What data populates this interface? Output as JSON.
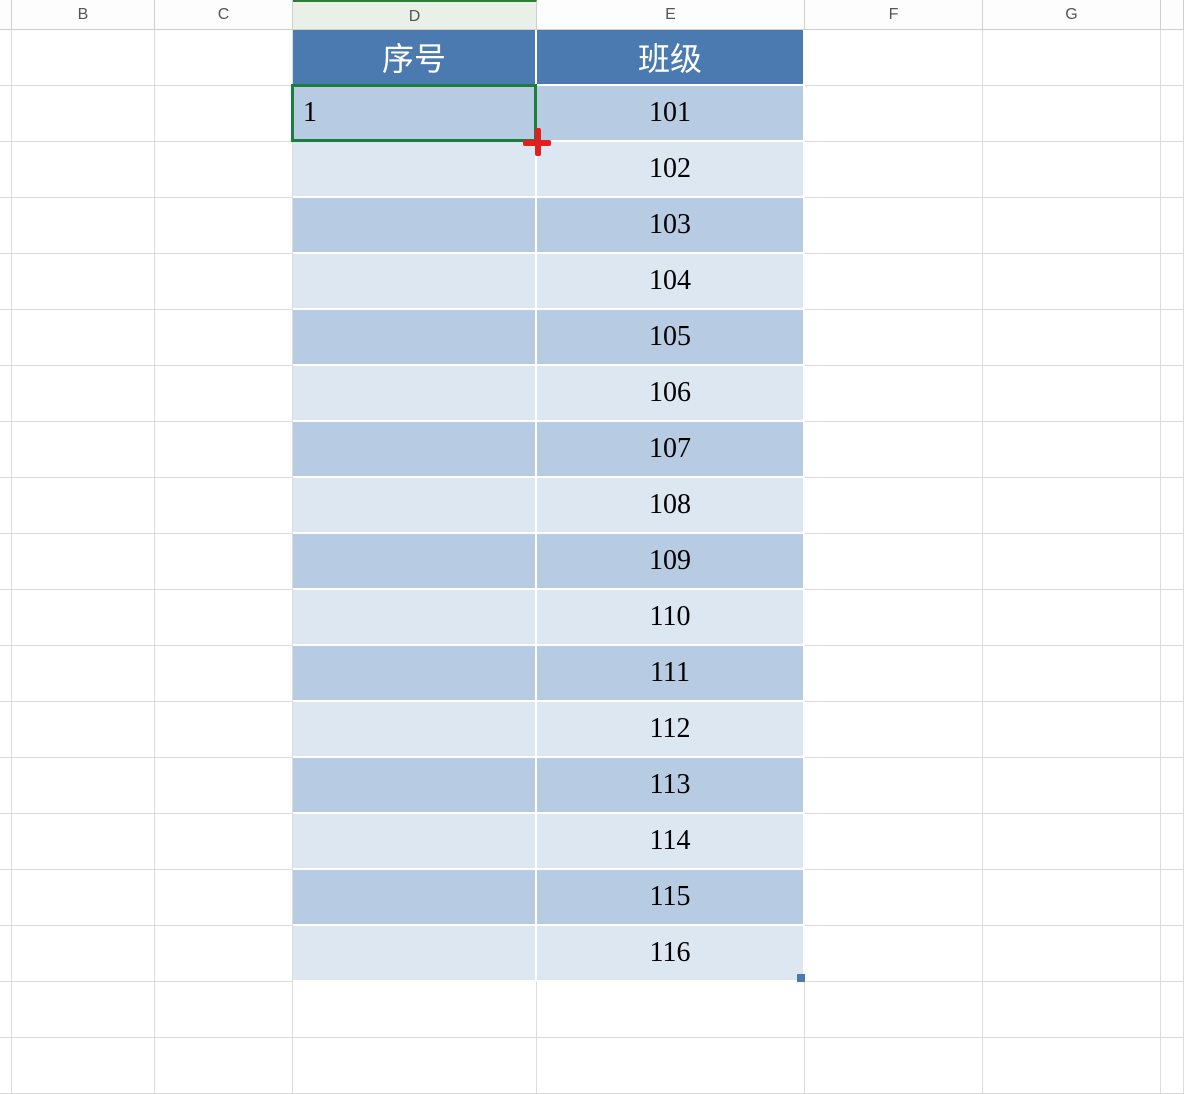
{
  "columns": {
    "a": "",
    "b": "B",
    "c": "C",
    "d": "D",
    "e": "E",
    "f": "F",
    "g": "G",
    "h": ""
  },
  "header": {
    "d": "序号",
    "e": "班级"
  },
  "selected_cell_value": "1",
  "data_rows": [
    {
      "d": "1",
      "e": "101"
    },
    {
      "d": "",
      "e": "102"
    },
    {
      "d": "",
      "e": "103"
    },
    {
      "d": "",
      "e": "104"
    },
    {
      "d": "",
      "e": "105"
    },
    {
      "d": "",
      "e": "106"
    },
    {
      "d": "",
      "e": "107"
    },
    {
      "d": "",
      "e": "108"
    },
    {
      "d": "",
      "e": "109"
    },
    {
      "d": "",
      "e": "110"
    },
    {
      "d": "",
      "e": "111"
    },
    {
      "d": "",
      "e": "112"
    },
    {
      "d": "",
      "e": "113"
    },
    {
      "d": "",
      "e": "114"
    },
    {
      "d": "",
      "e": "115"
    },
    {
      "d": "",
      "e": "116"
    }
  ],
  "colors": {
    "header_bg": "#4a7ab0",
    "stripe_dark": "#b7cce2",
    "stripe_light": "#dde7f1",
    "selection_border": "#1b7f3b",
    "fill_cursor": "#e02020"
  }
}
